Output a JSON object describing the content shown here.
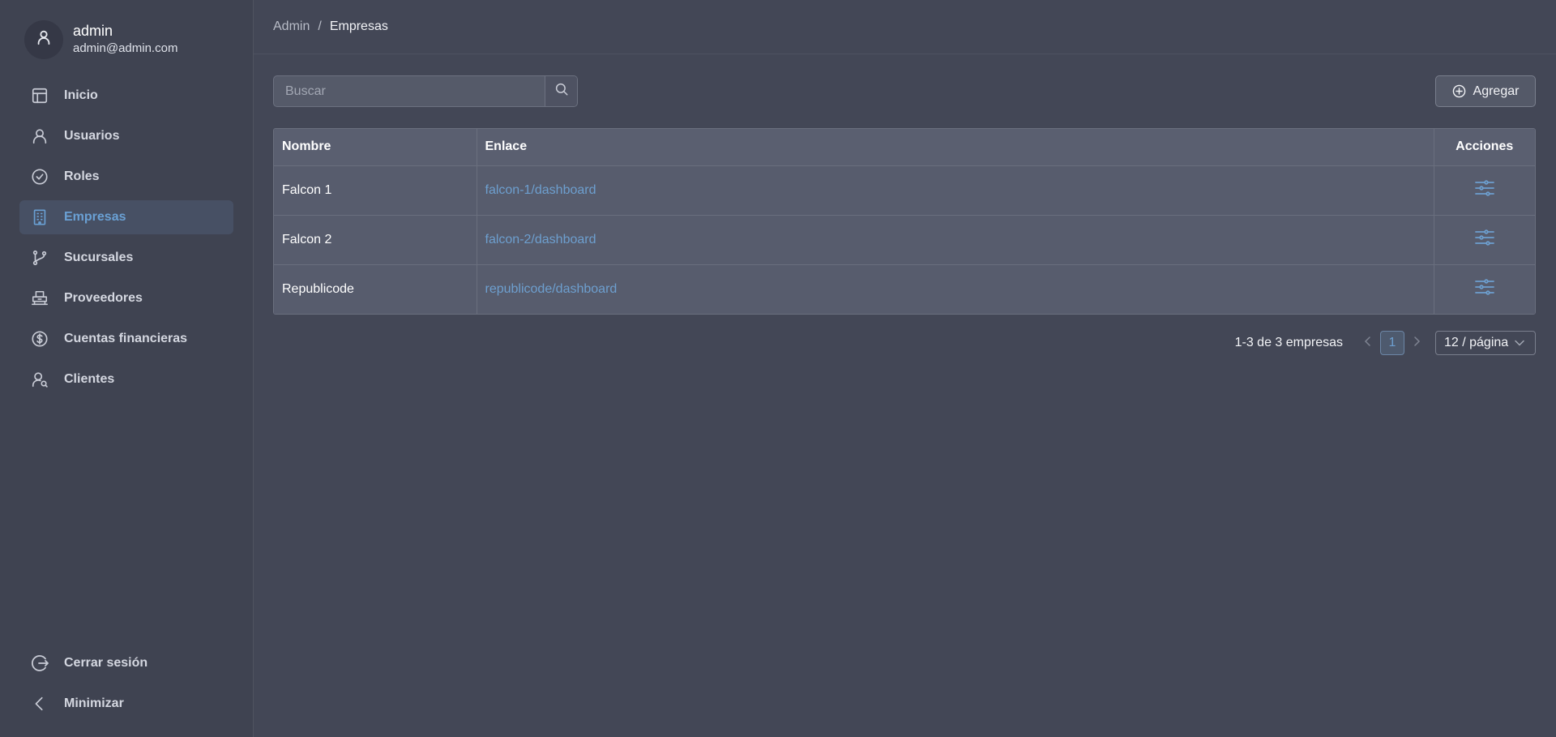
{
  "user": {
    "name": "admin",
    "email": "admin@admin.com"
  },
  "sidebar": {
    "items": [
      {
        "label": "Inicio",
        "icon": "layout-icon",
        "active": false
      },
      {
        "label": "Usuarios",
        "icon": "user-icon",
        "active": false
      },
      {
        "label": "Roles",
        "icon": "check-circle-icon",
        "active": false
      },
      {
        "label": "Empresas",
        "icon": "building-icon",
        "active": true
      },
      {
        "label": "Sucursales",
        "icon": "git-branch-icon",
        "active": false
      },
      {
        "label": "Proveedores",
        "icon": "supplier-icon",
        "active": false
      },
      {
        "label": "Cuentas financieras",
        "icon": "dollar-circle-icon",
        "active": false
      },
      {
        "label": "Clientes",
        "icon": "clients-icon",
        "active": false
      }
    ],
    "bottom": [
      {
        "label": "Cerrar sesión",
        "icon": "logout-icon"
      },
      {
        "label": "Minimizar",
        "icon": "chevron-left-icon"
      }
    ]
  },
  "breadcrumb": {
    "root": "Admin",
    "separator": "/",
    "current": "Empresas"
  },
  "search": {
    "placeholder": "Buscar",
    "value": ""
  },
  "add_button": {
    "label": "Agregar"
  },
  "table": {
    "columns": [
      "Nombre",
      "Enlace",
      "Acciones"
    ],
    "rows": [
      {
        "nombre": "Falcon 1",
        "enlace": "falcon-1/dashboard"
      },
      {
        "nombre": "Falcon 2",
        "enlace": "falcon-2/dashboard"
      },
      {
        "nombre": "Republicode",
        "enlace": "republicode/dashboard"
      }
    ]
  },
  "pagination": {
    "summary": "1-3 de 3 empresas",
    "current_page": "1",
    "page_size": "12 / página"
  },
  "colors": {
    "background": "#434756",
    "sidebar": "#3f4351",
    "accent": "#6d9fcf",
    "active_bg": "#475064"
  }
}
